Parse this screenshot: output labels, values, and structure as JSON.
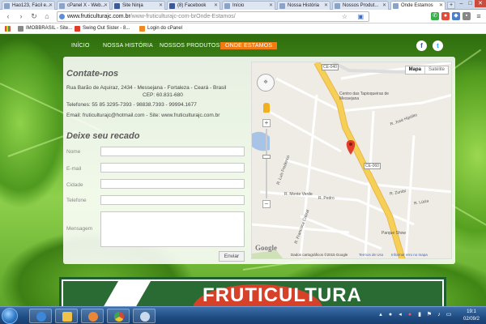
{
  "browser": {
    "tabs": [
      {
        "label": "Hao123, Fácil e...",
        "active": false
      },
      {
        "label": "cPanel X - Web...",
        "active": false
      },
      {
        "label": "Site Ninja",
        "active": false
      },
      {
        "label": "(8) Facebook",
        "active": false
      },
      {
        "label": "Início",
        "active": false
      },
      {
        "label": "Nossa História",
        "active": false
      },
      {
        "label": "Nossos Produt...",
        "active": false
      },
      {
        "label": "Onde Estamos",
        "active": true
      }
    ],
    "url_host": "www.fruticulturajc.com.br",
    "url_path": "/www-fruticulturajc-com-brOnde-Estamos/",
    "bookmarks": [
      "Apps",
      "IMOBBRASIL - Site...",
      "Swing Out Sister - 8...",
      "Login do cPanel"
    ]
  },
  "site": {
    "nav": [
      "INÍCIO",
      "NOSSA HISTÓRIA",
      "NOSSOS PRODUTOS",
      "ONDE ESTAMOS"
    ],
    "social": [
      "f",
      "t"
    ],
    "contact_title": "Contate-nos",
    "address_line1": "Rua Barão de Aquiraz, 2434 - Messejana - Fortaleza - Ceará - Brasil",
    "address_line2": "CEP: 60.831-680",
    "phones": "Telefones: 55 85 3295-7393 - 98838.7393 - 99994.1677",
    "email": "Email: fruticulturajc@hotmail.com - Site: www.fruticulturajc.com.br",
    "form_title": "Deixe seu recado",
    "fields": [
      "Nome",
      "E-mail",
      "Cidade",
      "Telefone",
      "Mensagem"
    ],
    "send_label": "Enviar",
    "banner_text": "FRUTICULTURA"
  },
  "map": {
    "type_map": "Mapa",
    "type_sat": "Satélite",
    "labels": [
      "Centro das Tapioqueiras de Messejana",
      "R. José Hipólito",
      "R. Luis Frederico",
      "R. Monte Verde",
      "R. Pedro",
      "R. Lúcia",
      "R. Zumbi",
      "R. Francisca Cabral",
      "Parque Show",
      "CE-040",
      "CE-060"
    ],
    "footer_data": "Dados cartográficos ©2015 Google",
    "footer_terms": "Termos de Uso",
    "footer_report": "Informar erro no mapa",
    "google": "Google"
  },
  "taskbar": {
    "time": "19:1",
    "date": "02/09/2"
  },
  "colors": {
    "nav_active": "#f07b13",
    "banner_green": "#2a6b33",
    "banner_red": "#d6412a",
    "road_yellow": "#f5cf56"
  }
}
